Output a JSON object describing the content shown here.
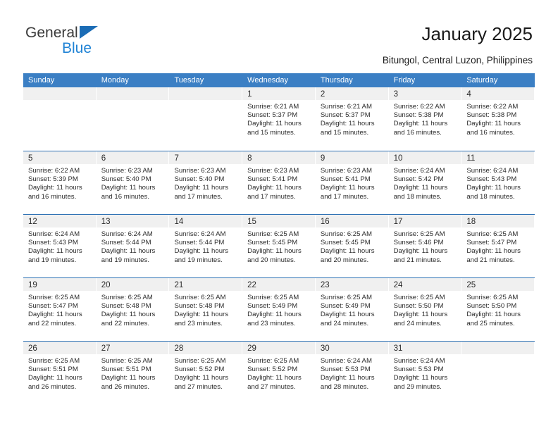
{
  "brand": {
    "name_top": "General",
    "name_bottom": "Blue",
    "triangle_color": "#1b6cb5",
    "blue_color": "#2083d5"
  },
  "header": {
    "title": "January 2025",
    "subtitle": "Bitungol, Central Luzon, Philippines"
  },
  "theme": {
    "header_row_bg": "#3b7fc4",
    "row_divider": "#2f72b5",
    "daynum_band_bg": "#f0f0f0",
    "text": "#2b2b2b"
  },
  "calendar": {
    "day_headers": [
      "Sunday",
      "Monday",
      "Tuesday",
      "Wednesday",
      "Thursday",
      "Friday",
      "Saturday"
    ],
    "weeks": [
      [
        {
          "day": "",
          "sunrise": "",
          "sunset": "",
          "daylight": "",
          "empty": true
        },
        {
          "day": "",
          "sunrise": "",
          "sunset": "",
          "daylight": "",
          "empty": true
        },
        {
          "day": "",
          "sunrise": "",
          "sunset": "",
          "daylight": "",
          "empty": true
        },
        {
          "day": "1",
          "sunrise": "Sunrise: 6:21 AM",
          "sunset": "Sunset: 5:37 PM",
          "daylight": "Daylight: 11 hours and 15 minutes.",
          "empty": false
        },
        {
          "day": "2",
          "sunrise": "Sunrise: 6:21 AM",
          "sunset": "Sunset: 5:37 PM",
          "daylight": "Daylight: 11 hours and 15 minutes.",
          "empty": false
        },
        {
          "day": "3",
          "sunrise": "Sunrise: 6:22 AM",
          "sunset": "Sunset: 5:38 PM",
          "daylight": "Daylight: 11 hours and 16 minutes.",
          "empty": false
        },
        {
          "day": "4",
          "sunrise": "Sunrise: 6:22 AM",
          "sunset": "Sunset: 5:38 PM",
          "daylight": "Daylight: 11 hours and 16 minutes.",
          "empty": false
        }
      ],
      [
        {
          "day": "5",
          "sunrise": "Sunrise: 6:22 AM",
          "sunset": "Sunset: 5:39 PM",
          "daylight": "Daylight: 11 hours and 16 minutes.",
          "empty": false
        },
        {
          "day": "6",
          "sunrise": "Sunrise: 6:23 AM",
          "sunset": "Sunset: 5:40 PM",
          "daylight": "Daylight: 11 hours and 16 minutes.",
          "empty": false
        },
        {
          "day": "7",
          "sunrise": "Sunrise: 6:23 AM",
          "sunset": "Sunset: 5:40 PM",
          "daylight": "Daylight: 11 hours and 17 minutes.",
          "empty": false
        },
        {
          "day": "8",
          "sunrise": "Sunrise: 6:23 AM",
          "sunset": "Sunset: 5:41 PM",
          "daylight": "Daylight: 11 hours and 17 minutes.",
          "empty": false
        },
        {
          "day": "9",
          "sunrise": "Sunrise: 6:23 AM",
          "sunset": "Sunset: 5:41 PM",
          "daylight": "Daylight: 11 hours and 17 minutes.",
          "empty": false
        },
        {
          "day": "10",
          "sunrise": "Sunrise: 6:24 AM",
          "sunset": "Sunset: 5:42 PM",
          "daylight": "Daylight: 11 hours and 18 minutes.",
          "empty": false
        },
        {
          "day": "11",
          "sunrise": "Sunrise: 6:24 AM",
          "sunset": "Sunset: 5:43 PM",
          "daylight": "Daylight: 11 hours and 18 minutes.",
          "empty": false
        }
      ],
      [
        {
          "day": "12",
          "sunrise": "Sunrise: 6:24 AM",
          "sunset": "Sunset: 5:43 PM",
          "daylight": "Daylight: 11 hours and 19 minutes.",
          "empty": false
        },
        {
          "day": "13",
          "sunrise": "Sunrise: 6:24 AM",
          "sunset": "Sunset: 5:44 PM",
          "daylight": "Daylight: 11 hours and 19 minutes.",
          "empty": false
        },
        {
          "day": "14",
          "sunrise": "Sunrise: 6:24 AM",
          "sunset": "Sunset: 5:44 PM",
          "daylight": "Daylight: 11 hours and 19 minutes.",
          "empty": false
        },
        {
          "day": "15",
          "sunrise": "Sunrise: 6:25 AM",
          "sunset": "Sunset: 5:45 PM",
          "daylight": "Daylight: 11 hours and 20 minutes.",
          "empty": false
        },
        {
          "day": "16",
          "sunrise": "Sunrise: 6:25 AM",
          "sunset": "Sunset: 5:45 PM",
          "daylight": "Daylight: 11 hours and 20 minutes.",
          "empty": false
        },
        {
          "day": "17",
          "sunrise": "Sunrise: 6:25 AM",
          "sunset": "Sunset: 5:46 PM",
          "daylight": "Daylight: 11 hours and 21 minutes.",
          "empty": false
        },
        {
          "day": "18",
          "sunrise": "Sunrise: 6:25 AM",
          "sunset": "Sunset: 5:47 PM",
          "daylight": "Daylight: 11 hours and 21 minutes.",
          "empty": false
        }
      ],
      [
        {
          "day": "19",
          "sunrise": "Sunrise: 6:25 AM",
          "sunset": "Sunset: 5:47 PM",
          "daylight": "Daylight: 11 hours and 22 minutes.",
          "empty": false
        },
        {
          "day": "20",
          "sunrise": "Sunrise: 6:25 AM",
          "sunset": "Sunset: 5:48 PM",
          "daylight": "Daylight: 11 hours and 22 minutes.",
          "empty": false
        },
        {
          "day": "21",
          "sunrise": "Sunrise: 6:25 AM",
          "sunset": "Sunset: 5:48 PM",
          "daylight": "Daylight: 11 hours and 23 minutes.",
          "empty": false
        },
        {
          "day": "22",
          "sunrise": "Sunrise: 6:25 AM",
          "sunset": "Sunset: 5:49 PM",
          "daylight": "Daylight: 11 hours and 23 minutes.",
          "empty": false
        },
        {
          "day": "23",
          "sunrise": "Sunrise: 6:25 AM",
          "sunset": "Sunset: 5:49 PM",
          "daylight": "Daylight: 11 hours and 24 minutes.",
          "empty": false
        },
        {
          "day": "24",
          "sunrise": "Sunrise: 6:25 AM",
          "sunset": "Sunset: 5:50 PM",
          "daylight": "Daylight: 11 hours and 24 minutes.",
          "empty": false
        },
        {
          "day": "25",
          "sunrise": "Sunrise: 6:25 AM",
          "sunset": "Sunset: 5:50 PM",
          "daylight": "Daylight: 11 hours and 25 minutes.",
          "empty": false
        }
      ],
      [
        {
          "day": "26",
          "sunrise": "Sunrise: 6:25 AM",
          "sunset": "Sunset: 5:51 PM",
          "daylight": "Daylight: 11 hours and 26 minutes.",
          "empty": false
        },
        {
          "day": "27",
          "sunrise": "Sunrise: 6:25 AM",
          "sunset": "Sunset: 5:51 PM",
          "daylight": "Daylight: 11 hours and 26 minutes.",
          "empty": false
        },
        {
          "day": "28",
          "sunrise": "Sunrise: 6:25 AM",
          "sunset": "Sunset: 5:52 PM",
          "daylight": "Daylight: 11 hours and 27 minutes.",
          "empty": false
        },
        {
          "day": "29",
          "sunrise": "Sunrise: 6:25 AM",
          "sunset": "Sunset: 5:52 PM",
          "daylight": "Daylight: 11 hours and 27 minutes.",
          "empty": false
        },
        {
          "day": "30",
          "sunrise": "Sunrise: 6:24 AM",
          "sunset": "Sunset: 5:53 PM",
          "daylight": "Daylight: 11 hours and 28 minutes.",
          "empty": false
        },
        {
          "day": "31",
          "sunrise": "Sunrise: 6:24 AM",
          "sunset": "Sunset: 5:53 PM",
          "daylight": "Daylight: 11 hours and 29 minutes.",
          "empty": false
        },
        {
          "day": "",
          "sunrise": "",
          "sunset": "",
          "daylight": "",
          "empty": true
        }
      ]
    ]
  }
}
